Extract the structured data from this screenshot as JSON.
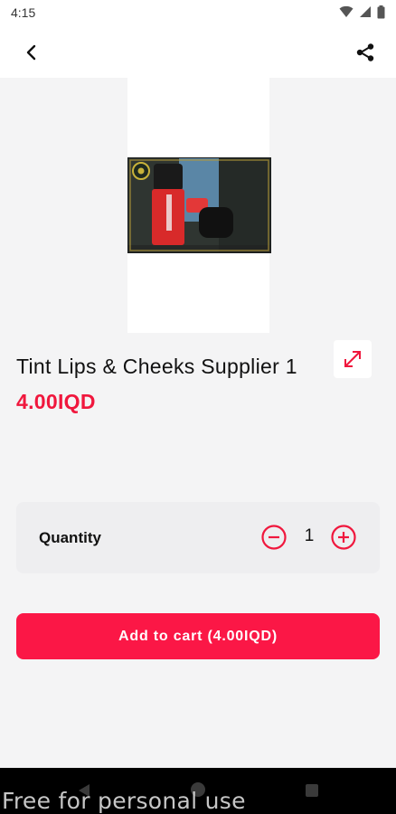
{
  "status_bar": {
    "time": "4:15"
  },
  "product": {
    "title": "Tint Lips & Cheeks Supplier 1",
    "price": "4.00IQD"
  },
  "quantity": {
    "label": "Quantity",
    "value": "1"
  },
  "cta": {
    "add_to_cart_label": "Add to cart (4.00IQD)"
  },
  "watermark": "Free for personal use",
  "colors": {
    "accent": "#f0173d",
    "button": "#fb1746",
    "background": "#f4f4f5",
    "card": "#eeeef0"
  },
  "icons": {
    "back": "back-arrow-icon",
    "share": "share-icon",
    "expand": "expand-icon",
    "minus": "minus-circle-icon",
    "plus": "plus-circle-icon"
  }
}
